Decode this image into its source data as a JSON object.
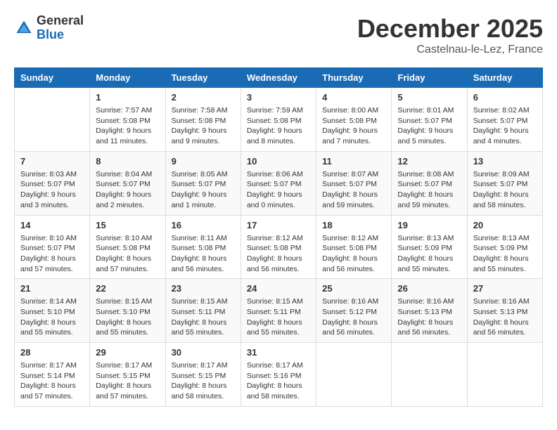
{
  "header": {
    "logo_general": "General",
    "logo_blue": "Blue",
    "month_title": "December 2025",
    "location": "Castelnau-le-Lez, France"
  },
  "columns": [
    "Sunday",
    "Monday",
    "Tuesday",
    "Wednesday",
    "Thursday",
    "Friday",
    "Saturday"
  ],
  "weeks": [
    [
      {
        "day": "",
        "info": ""
      },
      {
        "day": "1",
        "info": "Sunrise: 7:57 AM\nSunset: 5:08 PM\nDaylight: 9 hours\nand 11 minutes."
      },
      {
        "day": "2",
        "info": "Sunrise: 7:58 AM\nSunset: 5:08 PM\nDaylight: 9 hours\nand 9 minutes."
      },
      {
        "day": "3",
        "info": "Sunrise: 7:59 AM\nSunset: 5:08 PM\nDaylight: 9 hours\nand 8 minutes."
      },
      {
        "day": "4",
        "info": "Sunrise: 8:00 AM\nSunset: 5:08 PM\nDaylight: 9 hours\nand 7 minutes."
      },
      {
        "day": "5",
        "info": "Sunrise: 8:01 AM\nSunset: 5:07 PM\nDaylight: 9 hours\nand 5 minutes."
      },
      {
        "day": "6",
        "info": "Sunrise: 8:02 AM\nSunset: 5:07 PM\nDaylight: 9 hours\nand 4 minutes."
      }
    ],
    [
      {
        "day": "7",
        "info": "Sunrise: 8:03 AM\nSunset: 5:07 PM\nDaylight: 9 hours\nand 3 minutes."
      },
      {
        "day": "8",
        "info": "Sunrise: 8:04 AM\nSunset: 5:07 PM\nDaylight: 9 hours\nand 2 minutes."
      },
      {
        "day": "9",
        "info": "Sunrise: 8:05 AM\nSunset: 5:07 PM\nDaylight: 9 hours\nand 1 minute."
      },
      {
        "day": "10",
        "info": "Sunrise: 8:06 AM\nSunset: 5:07 PM\nDaylight: 9 hours\nand 0 minutes."
      },
      {
        "day": "11",
        "info": "Sunrise: 8:07 AM\nSunset: 5:07 PM\nDaylight: 8 hours\nand 59 minutes."
      },
      {
        "day": "12",
        "info": "Sunrise: 8:08 AM\nSunset: 5:07 PM\nDaylight: 8 hours\nand 59 minutes."
      },
      {
        "day": "13",
        "info": "Sunrise: 8:09 AM\nSunset: 5:07 PM\nDaylight: 8 hours\nand 58 minutes."
      }
    ],
    [
      {
        "day": "14",
        "info": "Sunrise: 8:10 AM\nSunset: 5:07 PM\nDaylight: 8 hours\nand 57 minutes."
      },
      {
        "day": "15",
        "info": "Sunrise: 8:10 AM\nSunset: 5:08 PM\nDaylight: 8 hours\nand 57 minutes."
      },
      {
        "day": "16",
        "info": "Sunrise: 8:11 AM\nSunset: 5:08 PM\nDaylight: 8 hours\nand 56 minutes."
      },
      {
        "day": "17",
        "info": "Sunrise: 8:12 AM\nSunset: 5:08 PM\nDaylight: 8 hours\nand 56 minutes."
      },
      {
        "day": "18",
        "info": "Sunrise: 8:12 AM\nSunset: 5:08 PM\nDaylight: 8 hours\nand 56 minutes."
      },
      {
        "day": "19",
        "info": "Sunrise: 8:13 AM\nSunset: 5:09 PM\nDaylight: 8 hours\nand 55 minutes."
      },
      {
        "day": "20",
        "info": "Sunrise: 8:13 AM\nSunset: 5:09 PM\nDaylight: 8 hours\nand 55 minutes."
      }
    ],
    [
      {
        "day": "21",
        "info": "Sunrise: 8:14 AM\nSunset: 5:10 PM\nDaylight: 8 hours\nand 55 minutes."
      },
      {
        "day": "22",
        "info": "Sunrise: 8:15 AM\nSunset: 5:10 PM\nDaylight: 8 hours\nand 55 minutes."
      },
      {
        "day": "23",
        "info": "Sunrise: 8:15 AM\nSunset: 5:11 PM\nDaylight: 8 hours\nand 55 minutes."
      },
      {
        "day": "24",
        "info": "Sunrise: 8:15 AM\nSunset: 5:11 PM\nDaylight: 8 hours\nand 55 minutes."
      },
      {
        "day": "25",
        "info": "Sunrise: 8:16 AM\nSunset: 5:12 PM\nDaylight: 8 hours\nand 56 minutes."
      },
      {
        "day": "26",
        "info": "Sunrise: 8:16 AM\nSunset: 5:13 PM\nDaylight: 8 hours\nand 56 minutes."
      },
      {
        "day": "27",
        "info": "Sunrise: 8:16 AM\nSunset: 5:13 PM\nDaylight: 8 hours\nand 56 minutes."
      }
    ],
    [
      {
        "day": "28",
        "info": "Sunrise: 8:17 AM\nSunset: 5:14 PM\nDaylight: 8 hours\nand 57 minutes."
      },
      {
        "day": "29",
        "info": "Sunrise: 8:17 AM\nSunset: 5:15 PM\nDaylight: 8 hours\nand 57 minutes."
      },
      {
        "day": "30",
        "info": "Sunrise: 8:17 AM\nSunset: 5:15 PM\nDaylight: 8 hours\nand 58 minutes."
      },
      {
        "day": "31",
        "info": "Sunrise: 8:17 AM\nSunset: 5:16 PM\nDaylight: 8 hours\nand 58 minutes."
      },
      {
        "day": "",
        "info": ""
      },
      {
        "day": "",
        "info": ""
      },
      {
        "day": "",
        "info": ""
      }
    ]
  ]
}
